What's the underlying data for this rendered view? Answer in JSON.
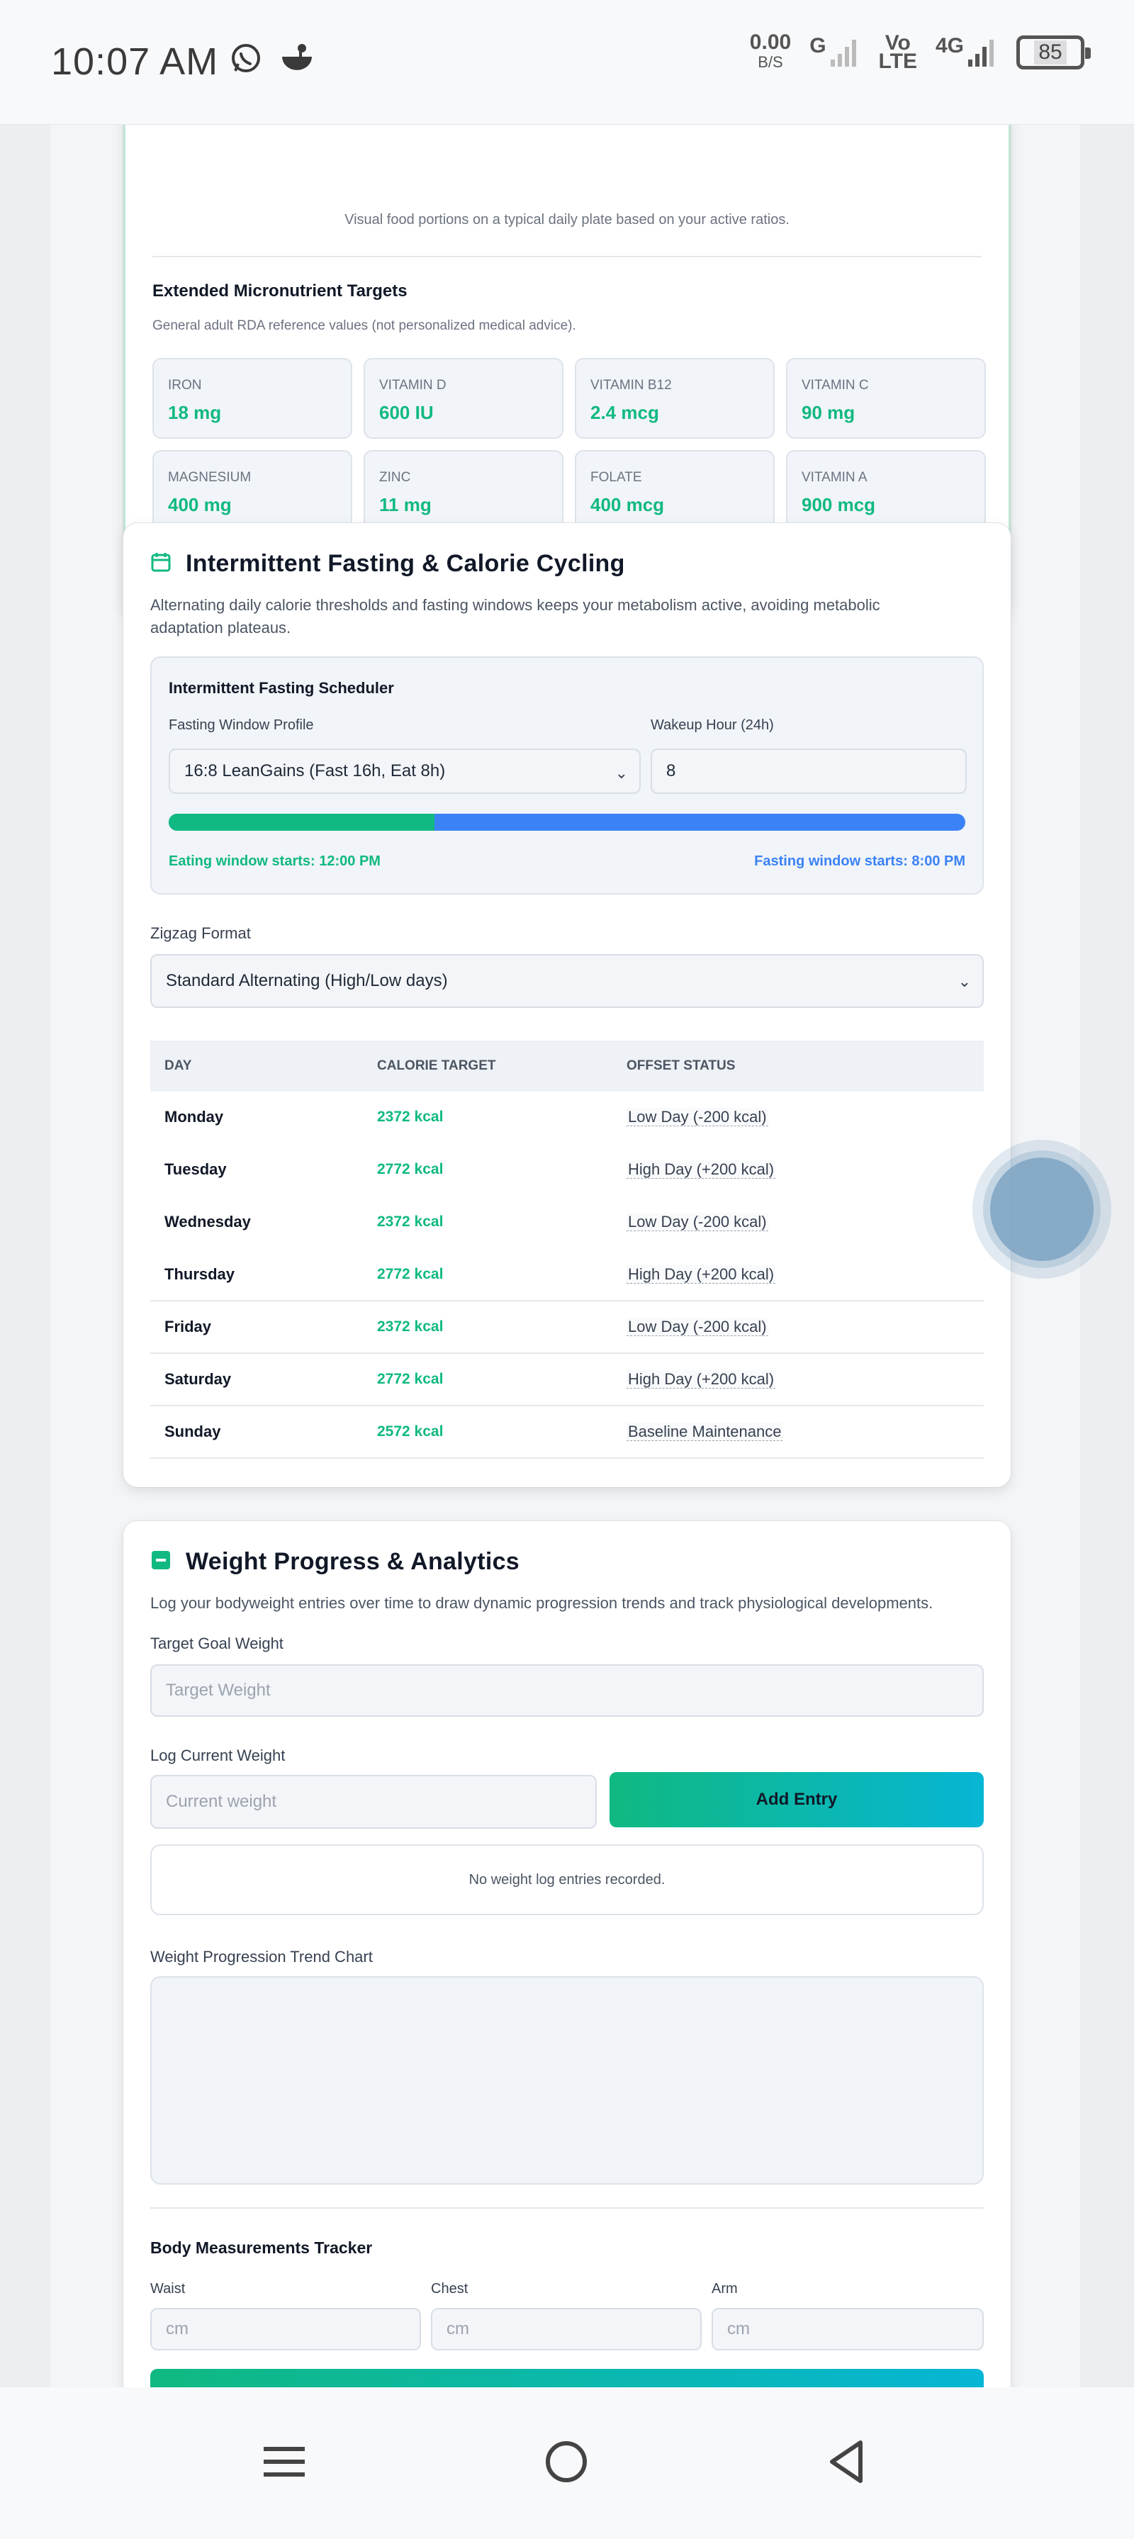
{
  "status_bar": {
    "time": "10:07 AM",
    "net_speed": "0.00",
    "net_unit": "B/S",
    "net_g": "G",
    "volte_top": "Vo",
    "volte_bottom": "LTE",
    "net_4g": "4G",
    "battery": "85"
  },
  "plate_section": {
    "caption": "Visual food portions on a typical daily plate based on your active ratios."
  },
  "micronutrients": {
    "title": "Extended Micronutrient Targets",
    "subtitle": "General adult RDA reference values (not personalized medical advice).",
    "items": [
      {
        "label": "IRON",
        "value": "18 mg"
      },
      {
        "label": "VITAMIN D",
        "value": "600 IU"
      },
      {
        "label": "VITAMIN B12",
        "value": "2.4 mcg"
      },
      {
        "label": "VITAMIN C",
        "value": "90 mg"
      },
      {
        "label": "MAGNESIUM",
        "value": "400 mg"
      },
      {
        "label": "ZINC",
        "value": "11 mg"
      },
      {
        "label": "FOLATE",
        "value": "400 mcg"
      },
      {
        "label": "VITAMIN A",
        "value": "900 mcg"
      }
    ]
  },
  "fasting": {
    "title": "Intermittent Fasting & Calorie Cycling",
    "description": "Alternating daily calorie thresholds and fasting windows keeps your metabolism active, avoiding metabolic adaptation plateaus.",
    "scheduler": {
      "title": "Intermittent Fasting Scheduler",
      "profile_label": "Fasting Window Profile",
      "profile_value": "16:8 LeanGains (Fast 16h, Eat 8h)",
      "wakeup_label": "Wakeup Hour (24h)",
      "wakeup_value": "8",
      "eating_fraction": 0.3333,
      "eating_text": "Eating window starts: 12:00 PM",
      "fasting_text": "Fasting window starts: 8:00 PM"
    },
    "zigzag_label": "Zigzag Format",
    "zigzag_value": "Standard Alternating (High/Low days)",
    "table": {
      "headers": [
        "DAY",
        "CALORIE TARGET",
        "OFFSET STATUS"
      ],
      "rows": [
        {
          "day": "Monday",
          "kcal": "2372 kcal",
          "status": "Low Day (-200 kcal)"
        },
        {
          "day": "Tuesday",
          "kcal": "2772 kcal",
          "status": "High Day (+200 kcal)"
        },
        {
          "day": "Wednesday",
          "kcal": "2372 kcal",
          "status": "Low Day (-200 kcal)"
        },
        {
          "day": "Thursday",
          "kcal": "2772 kcal",
          "status": "High Day (+200 kcal)"
        },
        {
          "day": "Friday",
          "kcal": "2372 kcal",
          "status": "Low Day (-200 kcal)"
        },
        {
          "day": "Saturday",
          "kcal": "2772 kcal",
          "status": "High Day (+200 kcal)"
        },
        {
          "day": "Sunday",
          "kcal": "2572 kcal",
          "status": "Baseline Maintenance"
        }
      ]
    }
  },
  "weight": {
    "title": "Weight Progress & Analytics",
    "description": "Log your bodyweight entries over time to draw dynamic progression trends and track physiological developments.",
    "goal_label": "Target Goal Weight",
    "goal_placeholder": "Target Weight",
    "log_label": "Log Current Weight",
    "log_placeholder": "Current weight",
    "add_button": "Add Entry",
    "empty_text": "No weight log entries recorded.",
    "chart_label": "Weight Progression Trend Chart",
    "measurements_title": "Body Measurements Tracker",
    "measurements": [
      {
        "label": "Waist",
        "placeholder": "cm"
      },
      {
        "label": "Chest",
        "placeholder": "cm"
      },
      {
        "label": "Arm",
        "placeholder": "cm"
      }
    ]
  },
  "colors": {
    "accent_green": "#10b981",
    "accent_blue": "#3b82f6",
    "gradient_end": "#06b6d4"
  },
  "icons": {
    "status": [
      "whatsapp-icon",
      "chef-hat-icon",
      "signal-icon",
      "battery-icon"
    ],
    "nav": [
      "menu-icon",
      "home-circle-icon",
      "back-triangle-icon"
    ]
  }
}
